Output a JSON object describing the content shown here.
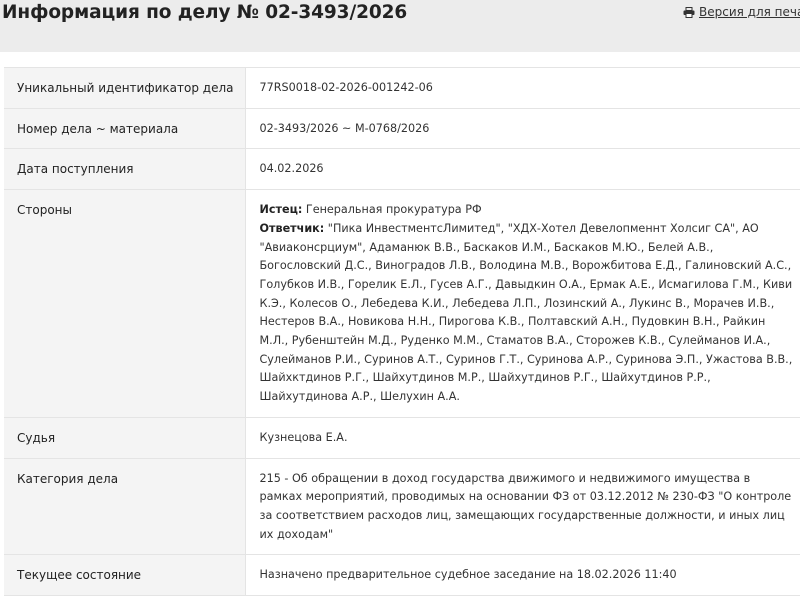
{
  "header": {
    "title": "Информация по делу № 02-3493/2026",
    "print_link": "Версия для печати"
  },
  "rows": [
    {
      "label": "Уникальный идентификатор дела",
      "value": "77RS0018-02-2026-001242-06"
    },
    {
      "label": "Номер дела ~ материала",
      "value": "02-3493/2026 ~ М-0768/2026"
    },
    {
      "label": "Дата поступления",
      "value": "04.02.2026"
    },
    {
      "label": "Стороны"
    },
    {
      "label": "Судья",
      "value": "Кузнецова Е.А."
    },
    {
      "label": "Категория дела",
      "value": "215 - Об обращении в доход государства движимого и недвижимого имущества в рамках мероприятий, проводимых на основании ФЗ от 03.12.2012 № 230-ФЗ \"О контроле за соответствием расходов лиц, замещающих государственные должности, и иных лиц их доходам\""
    },
    {
      "label": "Текущее состояние",
      "value": "Назначено предварительное судебное заседание на 18.02.2026 11:40"
    }
  ],
  "parties": {
    "plaintiff_label": "Истец:",
    "plaintiff": "Генеральная прокуратура РФ",
    "defendant_label": "Ответчик:",
    "defendant": "\"Пика ИнвестментсЛимитед\", \"ХДХ-Хотел Девелопменнт Холсиг СА\", АО \"Авиаконсрциум\", Адаманюк В.В., Баскаков И.М., Баскаков М.Ю., Белей А.В., Богословский Д.С., Виноградов Л.В., Володина М.В., Ворожбитова Е.Д., Галиновский А.С., Голубков И.В., Горелик Е.Л., Гусев А.Г., Давыдкин О.А., Ермак А.Е., Исмагилова Г.М., Киви К.Э., Колесов О., Лебедева К.И., Лебедева Л.П., Лозинский А., Лукинс В., Морачев И.В., Нестеров В.А., Новикова Н.Н., Пирогова К.В., Полтавский А.Н., Пудовкин В.Н., Райкин М.Л., Рубенштейн М.Д., Руденко М.М., Стаматов В.А., Сторожев К.В., Сулейманов И.А., Сулейманов Р.И., Суринов А.Т., Суринов Г.Т., Суринова А.Р., Суринова Э.П., Ужастова В.В., Шайхктдинов Р.Г., Шайхутдинов М.Р., Шайхутдинов Р.Г., Шайхутдинов Р.Р., Шайхутдинова А.Р., Шелухин А.А."
  },
  "icons": {
    "print": "printer-icon"
  }
}
